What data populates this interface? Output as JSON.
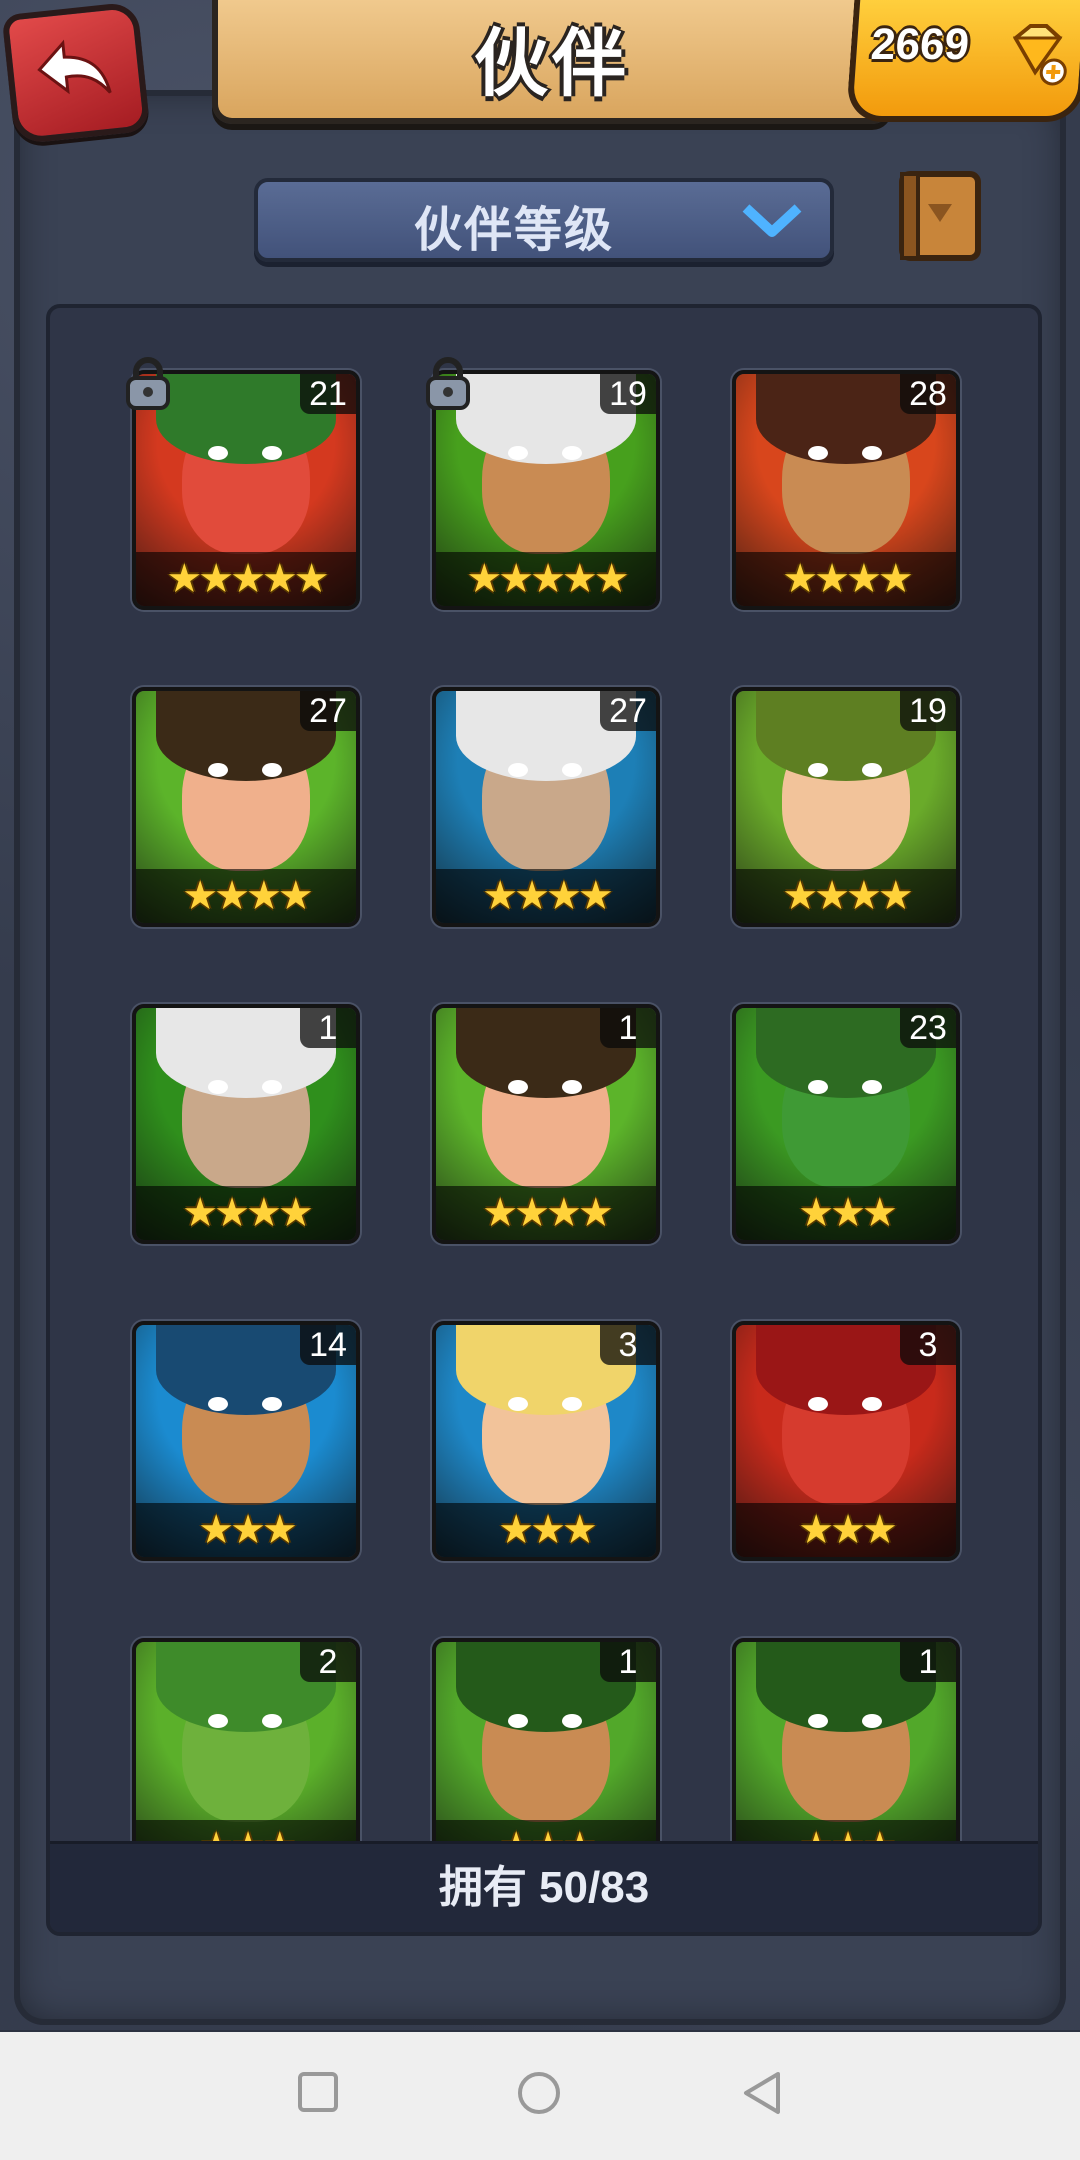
{
  "header": {
    "title": "伙伴"
  },
  "currency": {
    "value": "2669",
    "icon": "gem-icon"
  },
  "sort": {
    "label": "伙伴等级"
  },
  "footer": {
    "owned_label": "拥有 50/83"
  },
  "companions": [
    {
      "level": "21",
      "stars": "★★★★★",
      "locked": true,
      "bg": "#d4391f",
      "hair": "#2f7a2a",
      "face": "#e14b3b"
    },
    {
      "level": "19",
      "stars": "★★★★★",
      "locked": true,
      "bg": "#47a01d",
      "hair": "#e6e6e6",
      "face": "#c98b53"
    },
    {
      "level": "28",
      "stars": "★★★★",
      "locked": false,
      "bg": "#d8461c",
      "hair": "#4b2416",
      "face": "#c98b53"
    },
    {
      "level": "27",
      "stars": "★★★★",
      "locked": false,
      "bg": "#5cb42a",
      "hair": "#3b2a17",
      "face": "#f0b08c"
    },
    {
      "level": "27",
      "stars": "★★★★",
      "locked": false,
      "bg": "#1d7fb6",
      "hair": "#e7e7e7",
      "face": "#c9a88a"
    },
    {
      "level": "19",
      "stars": "★★★★",
      "locked": false,
      "bg": "#6aab2a",
      "hair": "#5e7f22",
      "face": "#f2c39a"
    },
    {
      "level": "1",
      "stars": "★★★★",
      "locked": false,
      "bg": "#2f8f1c",
      "hair": "#e7e7e7",
      "face": "#c9a88a"
    },
    {
      "level": "1",
      "stars": "★★★★",
      "locked": false,
      "bg": "#5cb42a",
      "hair": "#3b2a17",
      "face": "#f0b08c"
    },
    {
      "level": "23",
      "stars": "★★★",
      "locked": false,
      "bg": "#3b9a22",
      "hair": "#2d6b22",
      "face": "#3f9a35"
    },
    {
      "level": "14",
      "stars": "★★★",
      "locked": false,
      "bg": "#1b8bd0",
      "hair": "#184a72",
      "face": "#c98b53"
    },
    {
      "level": "3",
      "stars": "★★★",
      "locked": false,
      "bg": "#1e88c8",
      "hair": "#f0d46a",
      "face": "#f2c39a"
    },
    {
      "level": "3",
      "stars": "★★★",
      "locked": false,
      "bg": "#c82a1b",
      "hair": "#9a1616",
      "face": "#d63b2e"
    },
    {
      "level": "2",
      "stars": "★★★",
      "locked": false,
      "bg": "#5bb02a",
      "hair": "#3e8b2a",
      "face": "#6eb13c"
    },
    {
      "level": "1",
      "stars": "★★★",
      "locked": false,
      "bg": "#52a82a",
      "hair": "#245a1a",
      "face": "#c98b53"
    },
    {
      "level": "1",
      "stars": "★★★",
      "locked": false,
      "bg": "#52a82a",
      "hair": "#245a1a",
      "face": "#c98b53"
    }
  ],
  "navbar": {
    "buttons": [
      "recent-apps",
      "home",
      "back"
    ]
  }
}
